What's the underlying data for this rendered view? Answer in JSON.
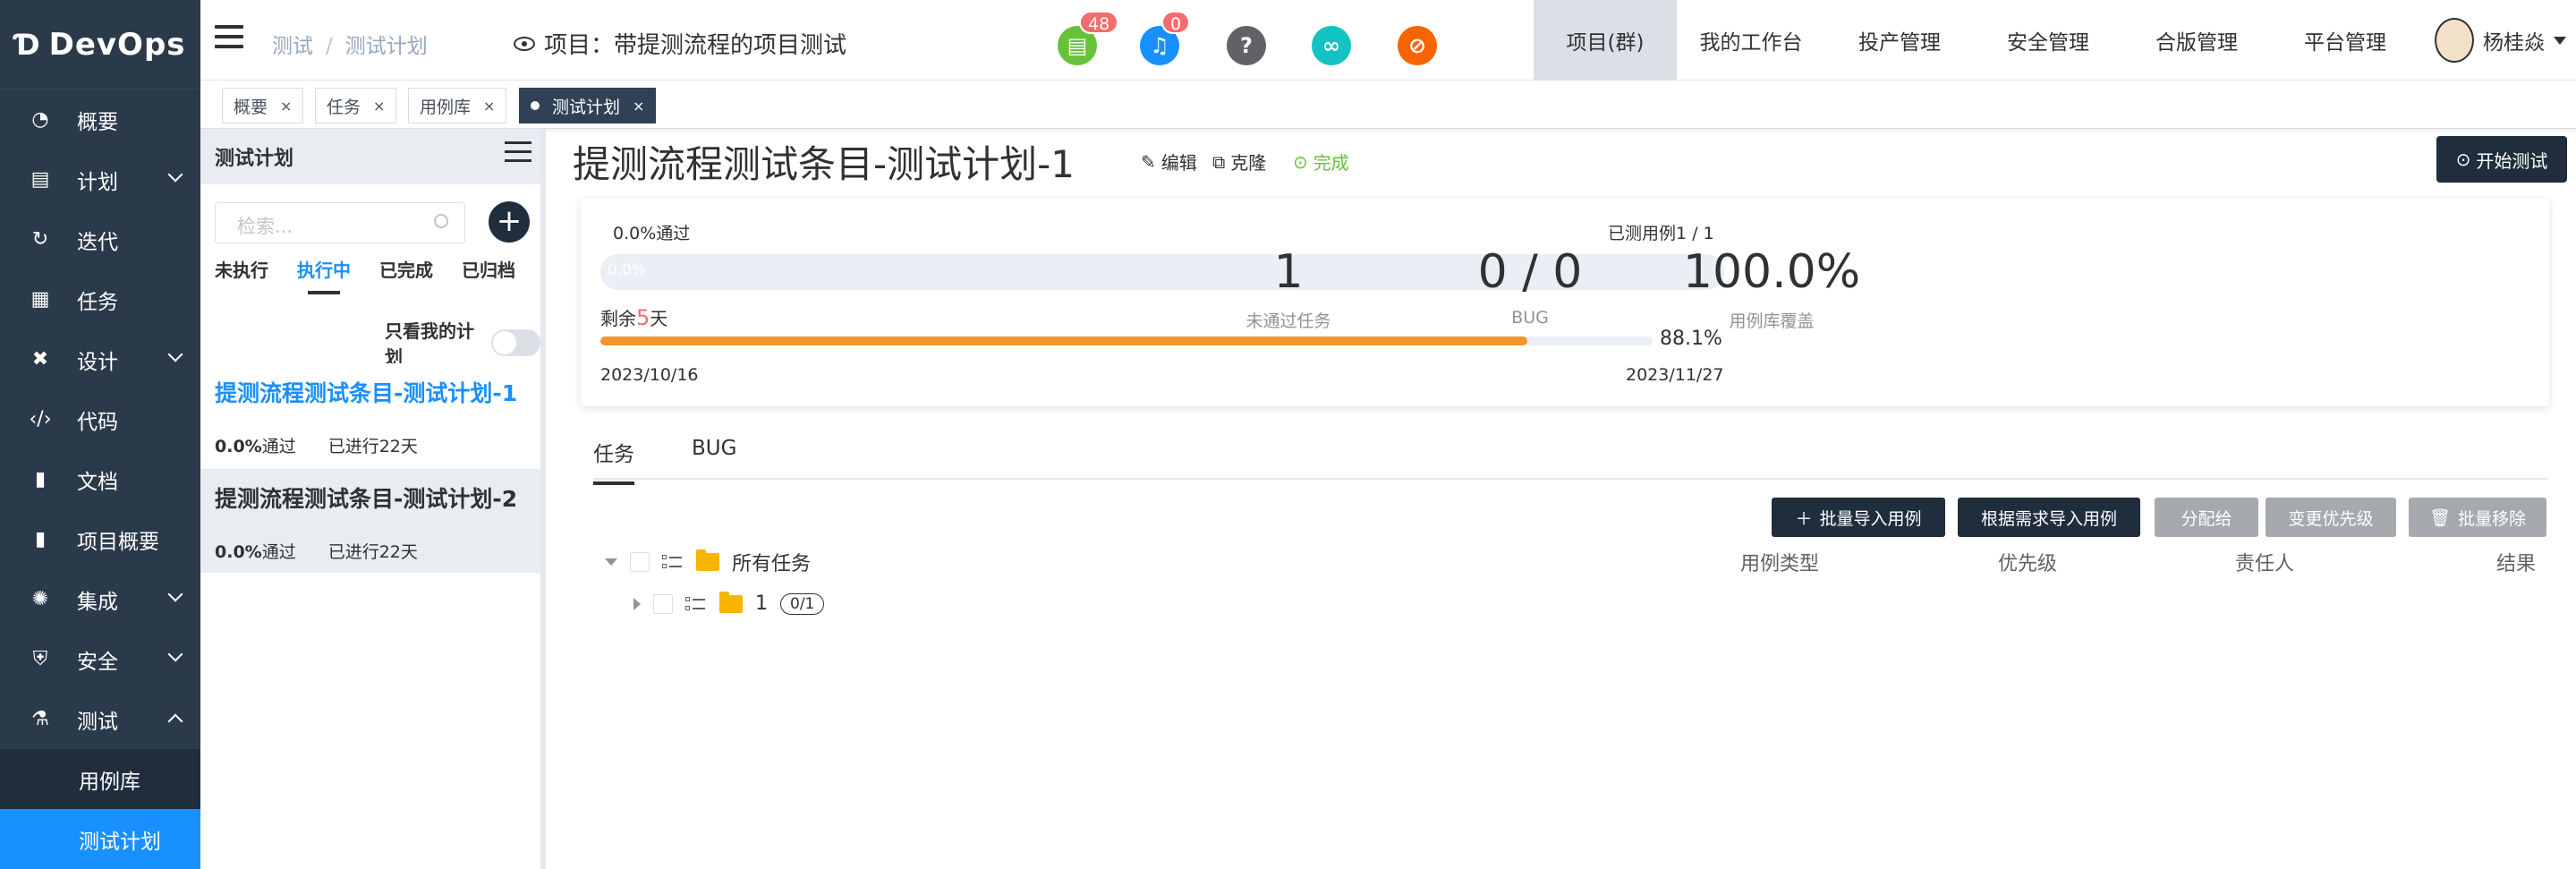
{
  "sidebar": {
    "logo_mark": "Ɗ",
    "logo_text": "DevOps",
    "items": [
      {
        "label": "概要",
        "icon": "dashboard-icon",
        "glyph": "◔",
        "chevron": ""
      },
      {
        "label": "计划",
        "icon": "plan-icon",
        "glyph": "▤",
        "chevron": "down"
      },
      {
        "label": "迭代",
        "icon": "iteration-icon",
        "glyph": "↻",
        "chevron": ""
      },
      {
        "label": "任务",
        "icon": "task-icon",
        "glyph": "▦",
        "chevron": ""
      },
      {
        "label": "设计",
        "icon": "design-icon",
        "glyph": "✖",
        "chevron": "down"
      },
      {
        "label": "代码",
        "icon": "code-icon",
        "glyph": "‹/›",
        "chevron": ""
      },
      {
        "label": "文档",
        "icon": "document-icon",
        "glyph": "▮",
        "chevron": ""
      },
      {
        "label": "项目概要",
        "icon": "project-summary-icon",
        "glyph": "▮",
        "chevron": ""
      },
      {
        "label": "集成",
        "icon": "integration-icon",
        "glyph": "✺",
        "chevron": "down"
      },
      {
        "label": "安全",
        "icon": "shield-icon",
        "glyph": "⛨",
        "chevron": "down"
      },
      {
        "label": "测试",
        "icon": "flask-icon",
        "glyph": "⚗",
        "chevron": "up"
      }
    ],
    "sub_items": [
      {
        "label": "用例库",
        "active": false
      },
      {
        "label": "测试计划",
        "active": true
      }
    ]
  },
  "header": {
    "breadcrumb": [
      "测试",
      "测试计划"
    ],
    "project": "项目：带提测流程的项目测试",
    "icons": [
      {
        "name": "notes-icon",
        "glyph": "▤",
        "color": "#67c23a",
        "badge": "48"
      },
      {
        "name": "bell-icon",
        "glyph": "♫",
        "color": "#1890ff",
        "badge": "0"
      },
      {
        "name": "help-icon",
        "glyph": "?",
        "color": "#606266",
        "badge": ""
      },
      {
        "name": "link-icon",
        "glyph": "∞",
        "color": "#13c2c2",
        "badge": ""
      },
      {
        "name": "no-pin-icon",
        "glyph": "⊘",
        "color": "#fa6400",
        "badge": ""
      }
    ],
    "nav": [
      "项目(群)",
      "我的工作台",
      "投产管理",
      "安全管理",
      "合版管理",
      "平台管理"
    ],
    "active_nav": "项目(群)",
    "user": "杨桂焱"
  },
  "tags": [
    {
      "label": "概要",
      "active": false
    },
    {
      "label": "任务",
      "active": false
    },
    {
      "label": "用例库",
      "active": false
    },
    {
      "label": "测试计划",
      "active": true
    }
  ],
  "plan_panel": {
    "title": "测试计划",
    "search_placeholder": "检索...",
    "tabs": [
      "未执行",
      "执行中",
      "已完成",
      "已归档"
    ],
    "active_tab": "执行中",
    "mine_only_label": "只看我的计划",
    "plans": [
      {
        "title": "提测流程测试条目-测试计划-1",
        "pass_rate": "0.0%",
        "pass_label": "通过",
        "elapsed": "已进行22天"
      },
      {
        "title": "提测流程测试条目-测试计划-2",
        "pass_rate": "0.0%",
        "pass_label": "通过",
        "elapsed": "已进行22天"
      }
    ]
  },
  "main": {
    "title": "提测流程测试条目-测试计划-1",
    "actions": {
      "edit": "编辑",
      "clone": "克隆",
      "complete": "完成"
    },
    "start_button": "开始测试",
    "summary": {
      "pass_text": "0.0%通过",
      "tested_text": "已测用例1 / 1",
      "pass_bar_label": "0.0%",
      "remain_prefix": "剩余",
      "remain_days": "5",
      "remain_suffix": "天",
      "time_progress": 88.1,
      "time_progress_text": "88.1%",
      "start_date": "2023/10/16",
      "end_date": "2023/11/27",
      "stats": [
        {
          "value": "1",
          "label": "未通过任务"
        },
        {
          "value": "0 / 0",
          "label": "BUG"
        },
        {
          "value": "100.0%",
          "label": "用例库覆盖"
        }
      ]
    },
    "tabs": [
      "任务",
      "BUG"
    ],
    "active_tab": "任务",
    "buttons": [
      {
        "label": "批量导入用例",
        "style": "dark",
        "icon": "＋"
      },
      {
        "label": "根据需求导入用例",
        "style": "dark",
        "icon": ""
      },
      {
        "label": "分配给",
        "style": "gray",
        "icon": ""
      },
      {
        "label": "变更优先级",
        "style": "gray",
        "icon": ""
      },
      {
        "label": "批量移除",
        "style": "gray",
        "icon": "🗑"
      }
    ],
    "columns": [
      "用例类型",
      "优先级",
      "责任人",
      "结果"
    ],
    "tree": {
      "root_label": "所有任务",
      "child_label": "1",
      "child_count": "0/1"
    }
  }
}
